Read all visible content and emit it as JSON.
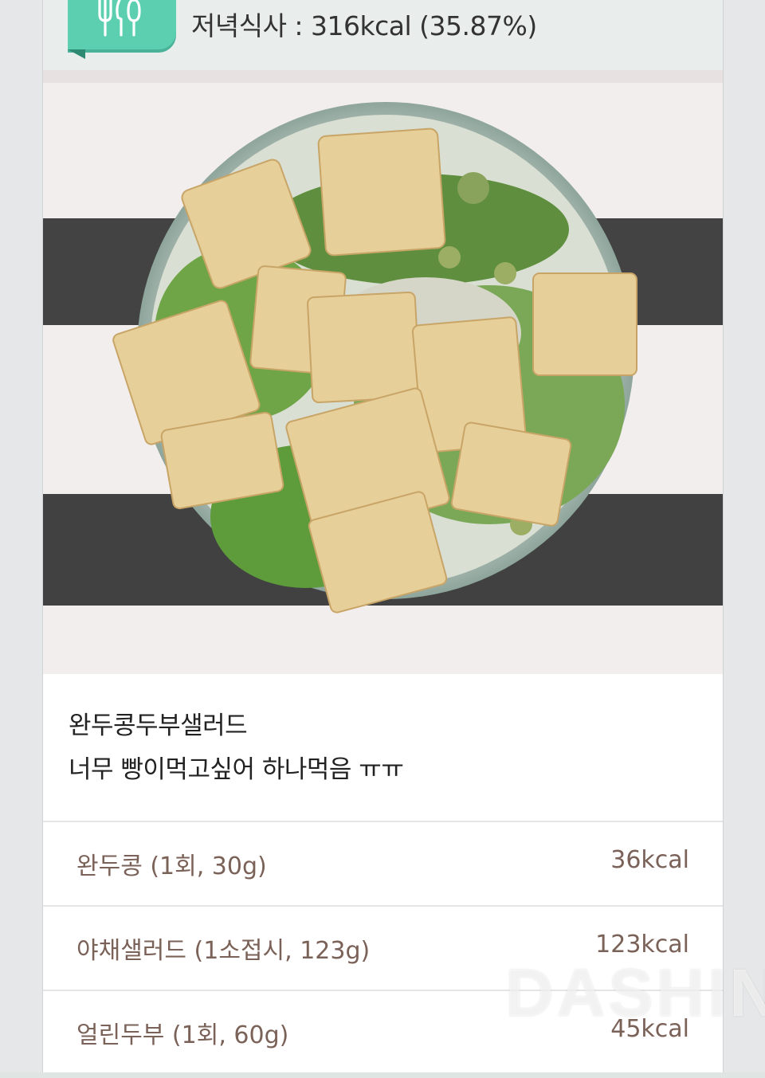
{
  "meal": {
    "title": "저녁식사 : 316kcal (35.87%)",
    "badge_icon": "utensils-icon",
    "accent_color": "#5ccfb1"
  },
  "memo": {
    "line1": "완두콩두부샐러드",
    "line2": "너무 빵이먹고싶어 하나먹음 ㅠㅠ"
  },
  "foods": [
    {
      "name": "완두콩 (1회, 30g)",
      "kcal": "36kcal"
    },
    {
      "name": "야채샐러드 (1소접시, 123g)",
      "kcal": "123kcal"
    },
    {
      "name": "얼린두부 (1회, 60g)",
      "kcal": "45kcal"
    }
  ],
  "watermark": "DASHIN"
}
